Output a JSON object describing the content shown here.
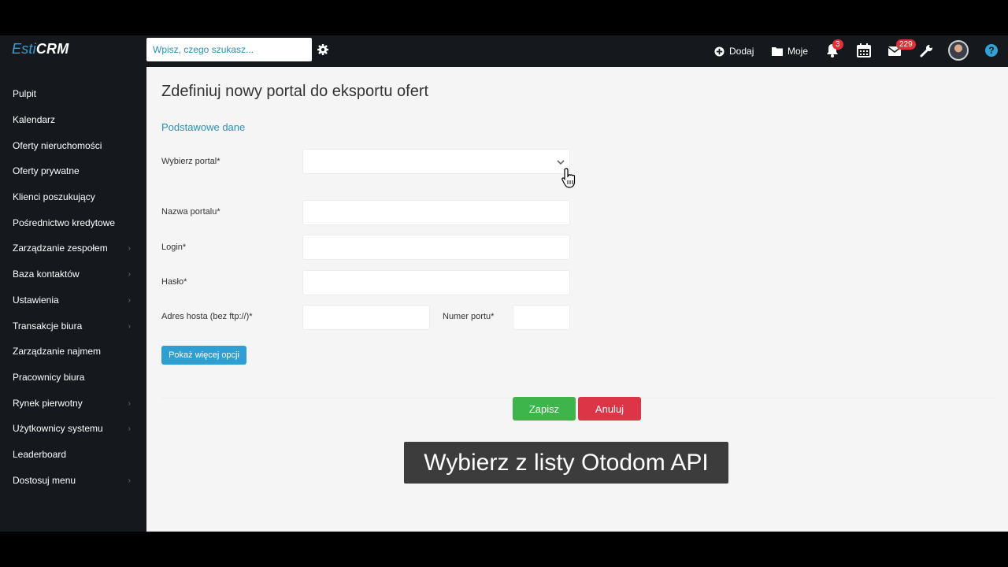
{
  "app": {
    "logo_light": "Esti",
    "logo_bold": "CRM"
  },
  "search": {
    "placeholder": "Wpisz, czego szukasz..."
  },
  "topbar": {
    "add_label": "Dodaj",
    "mine_label": "Moje",
    "notifications_count": "3",
    "messages_count": "229"
  },
  "sidebar": {
    "items": [
      {
        "label": "Pulpit",
        "has_submenu": false
      },
      {
        "label": "Kalendarz",
        "has_submenu": false
      },
      {
        "label": "Oferty nieruchomości",
        "has_submenu": false
      },
      {
        "label": "Oferty prywatne",
        "has_submenu": false
      },
      {
        "label": "Klienci poszukujący",
        "has_submenu": false
      },
      {
        "label": "Pośrednictwo kredytowe",
        "has_submenu": false
      },
      {
        "label": "Zarządzanie zespołem",
        "has_submenu": true
      },
      {
        "label": "Baza kontaktów",
        "has_submenu": true
      },
      {
        "label": "Ustawienia",
        "has_submenu": true
      },
      {
        "label": "Transakcje biura",
        "has_submenu": true
      },
      {
        "label": "Zarządzanie najmem",
        "has_submenu": false
      },
      {
        "label": "Pracownicy biura",
        "has_submenu": false
      },
      {
        "label": "Rynek pierwotny",
        "has_submenu": true
      },
      {
        "label": "Użytkownicy systemu",
        "has_submenu": true
      },
      {
        "label": "Leaderboard",
        "has_submenu": false
      },
      {
        "label": "Dostosuj menu",
        "has_submenu": true
      }
    ]
  },
  "main": {
    "title": "Zdefiniuj nowy portal do eksportu ofert",
    "section": "Podstawowe dane",
    "form": {
      "portal_label": "Wybierz portal*",
      "portal_value": "",
      "name_label": "Nazwa portalu*",
      "name_value": "",
      "login_label": "Login*",
      "login_value": "",
      "password_label": "Hasło*",
      "password_value": "",
      "host_label": "Adres hosta (bez ftp://)*",
      "host_value": "",
      "port_label": "Numer portu*",
      "port_value": ""
    },
    "more_options": "Pokaż więcej opcji",
    "save": "Zapisz",
    "cancel": "Anuluj"
  },
  "caption": "Wybierz z listy Otodom API",
  "colors": {
    "accent": "#2e9fd4",
    "save": "#3db54a",
    "cancel": "#dc3545",
    "sidebar_bg": "#15191d"
  }
}
